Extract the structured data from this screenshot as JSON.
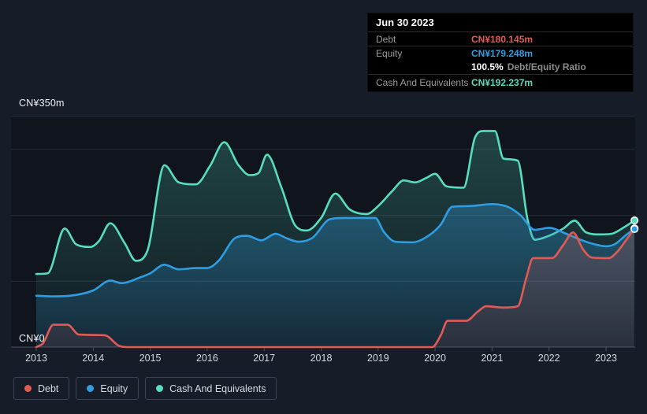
{
  "colors": {
    "page_bg": "#171d28",
    "plot_bg": "#0f141d",
    "grid": "#262d3a",
    "axis_line": "#3e4554",
    "tick": "#4a5261",
    "debt": "#e25a52",
    "equity": "#2f9de2",
    "cash": "#57ddbf",
    "tooltip_bg": "#000000",
    "tooltip_label": "#9b9b9b",
    "dot_ring": "#ffffff"
  },
  "tooltip": {
    "date": "Jun 30 2023",
    "debt_label": "Debt",
    "debt_value": "CN¥180.145m",
    "equity_label": "Equity",
    "equity_value": "CN¥179.248m",
    "ratio_value": "100.5%",
    "ratio_label": "Debt/Equity Ratio",
    "cash_label": "Cash And Equivalents",
    "cash_value": "CN¥192.237m"
  },
  "legend": {
    "items": [
      {
        "label": "Debt",
        "series": "Debt"
      },
      {
        "label": "Equity",
        "series": "Equity"
      },
      {
        "label": "Cash And Equivalents",
        "series": "Cash And Equivalents"
      }
    ]
  },
  "chart_data": {
    "type": "area",
    "unit": "CN¥ millions",
    "x_label": "",
    "y_label": "",
    "x_ticks": [
      2013,
      2014,
      2015,
      2016,
      2017,
      2018,
      2019,
      2020,
      2021,
      2022,
      2023
    ],
    "x_range": [
      2013,
      2023.5
    ],
    "y_axis": {
      "max": 350,
      "min": 0,
      "max_label": "CN¥350m",
      "min_label": "CN¥0",
      "gridline_values": [
        350,
        300,
        200,
        100
      ]
    },
    "legend_position": "bottom-left",
    "series": [
      {
        "name": "Debt",
        "color": "#e25a52",
        "end_value": 180.145,
        "points": [
          [
            2013.0,
            0
          ],
          [
            2013.12,
            6
          ],
          [
            2013.3,
            34
          ],
          [
            2013.55,
            34
          ],
          [
            2013.75,
            19
          ],
          [
            2014.2,
            18
          ],
          [
            2014.45,
            2
          ],
          [
            2014.6,
            0
          ],
          [
            2015.5,
            0
          ],
          [
            2016.5,
            0
          ],
          [
            2017.5,
            0
          ],
          [
            2018.5,
            0
          ],
          [
            2019.5,
            0
          ],
          [
            2019.95,
            0
          ],
          [
            2020.1,
            18
          ],
          [
            2020.22,
            40
          ],
          [
            2020.55,
            40
          ],
          [
            2020.75,
            54
          ],
          [
            2020.9,
            62
          ],
          [
            2021.2,
            60
          ],
          [
            2021.45,
            62
          ],
          [
            2021.6,
            105
          ],
          [
            2021.72,
            135
          ],
          [
            2022.05,
            135
          ],
          [
            2022.25,
            155
          ],
          [
            2022.42,
            174
          ],
          [
            2022.6,
            148
          ],
          [
            2022.75,
            136
          ],
          [
            2023.05,
            135
          ],
          [
            2023.2,
            145
          ],
          [
            2023.35,
            162
          ],
          [
            2023.5,
            180.145
          ]
        ]
      },
      {
        "name": "Equity",
        "color": "#2f9de2",
        "end_value": 179.248,
        "points": [
          [
            2013.0,
            78
          ],
          [
            2013.3,
            77
          ],
          [
            2013.6,
            78
          ],
          [
            2014.0,
            86
          ],
          [
            2014.3,
            101
          ],
          [
            2014.5,
            97
          ],
          [
            2014.8,
            105
          ],
          [
            2015.0,
            112
          ],
          [
            2015.25,
            125
          ],
          [
            2015.5,
            118
          ],
          [
            2015.8,
            120
          ],
          [
            2016.0,
            120
          ],
          [
            2016.2,
            131
          ],
          [
            2016.5,
            166
          ],
          [
            2016.7,
            169
          ],
          [
            2016.95,
            162
          ],
          [
            2017.2,
            172
          ],
          [
            2017.4,
            165
          ],
          [
            2017.6,
            160
          ],
          [
            2017.85,
            166
          ],
          [
            2018.15,
            194
          ],
          [
            2018.4,
            196
          ],
          [
            2018.95,
            196
          ],
          [
            2019.1,
            175
          ],
          [
            2019.3,
            160
          ],
          [
            2019.6,
            159
          ],
          [
            2019.9,
            170
          ],
          [
            2020.1,
            186
          ],
          [
            2020.3,
            213
          ],
          [
            2020.6,
            214
          ],
          [
            2021.0,
            217
          ],
          [
            2021.3,
            212
          ],
          [
            2021.5,
            200
          ],
          [
            2021.75,
            178
          ],
          [
            2022.0,
            181
          ],
          [
            2022.3,
            172
          ],
          [
            2022.55,
            163
          ],
          [
            2022.8,
            156
          ],
          [
            2023.0,
            153
          ],
          [
            2023.15,
            156
          ],
          [
            2023.35,
            170
          ],
          [
            2023.5,
            179.248
          ]
        ]
      },
      {
        "name": "Cash And Equivalents",
        "color": "#57ddbf",
        "end_value": 192.237,
        "points": [
          [
            2013.0,
            111
          ],
          [
            2013.2,
            112
          ],
          [
            2013.5,
            180
          ],
          [
            2013.7,
            156
          ],
          [
            2013.95,
            152
          ],
          [
            2014.1,
            161
          ],
          [
            2014.3,
            188
          ],
          [
            2014.55,
            158
          ],
          [
            2014.75,
            131
          ],
          [
            2014.95,
            146
          ],
          [
            2015.25,
            276
          ],
          [
            2015.5,
            250
          ],
          [
            2015.8,
            247
          ],
          [
            2016.05,
            275
          ],
          [
            2016.3,
            311
          ],
          [
            2016.55,
            276
          ],
          [
            2016.75,
            261
          ],
          [
            2016.9,
            264
          ],
          [
            2017.05,
            292
          ],
          [
            2017.3,
            243
          ],
          [
            2017.55,
            184
          ],
          [
            2017.75,
            177
          ],
          [
            2018.0,
            196
          ],
          [
            2018.25,
            233
          ],
          [
            2018.5,
            209
          ],
          [
            2018.8,
            202
          ],
          [
            2019.0,
            214
          ],
          [
            2019.25,
            237
          ],
          [
            2019.45,
            253
          ],
          [
            2019.65,
            250
          ],
          [
            2019.85,
            257
          ],
          [
            2020.0,
            263
          ],
          [
            2020.2,
            244
          ],
          [
            2020.5,
            242
          ],
          [
            2020.7,
            318
          ],
          [
            2020.85,
            328
          ],
          [
            2021.05,
            328
          ],
          [
            2021.2,
            286
          ],
          [
            2021.45,
            283
          ],
          [
            2021.62,
            195
          ],
          [
            2021.75,
            163
          ],
          [
            2022.0,
            169
          ],
          [
            2022.25,
            180
          ],
          [
            2022.45,
            192
          ],
          [
            2022.65,
            174
          ],
          [
            2022.9,
            171
          ],
          [
            2023.1,
            172
          ],
          [
            2023.3,
            181
          ],
          [
            2023.5,
            192.237
          ]
        ]
      }
    ]
  }
}
